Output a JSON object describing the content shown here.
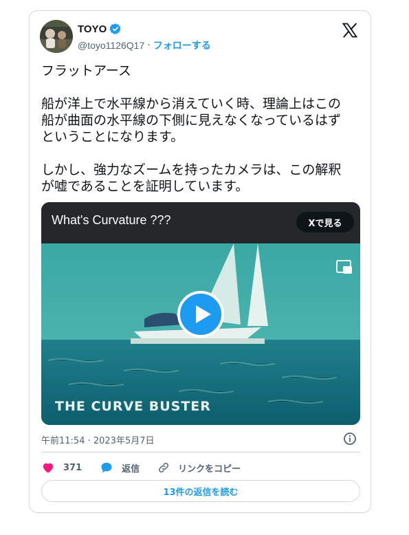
{
  "author": {
    "name": "TOYO",
    "handle": "@toyo1126Q17",
    "separator": "·",
    "follow_label": "フォローする"
  },
  "tweet": {
    "paragraphs": [
      "フラットアース",
      "船が洋上で水平線から消えていく時、理論上はこの\n船が曲面の水平線の下側に見えなくなっているはず\nということになります。",
      "しかし、強力なズームを持ったカメラは、この解釈\nが嘘であることを証明しています。"
    ]
  },
  "media": {
    "title": "What's Curvature  ???",
    "watch_label": "Xで見る",
    "overlay_text": "THE CURVE BUSTER"
  },
  "meta": {
    "timestamp": "午前11:54 · 2023年5月7日"
  },
  "actions": {
    "like_count": "371",
    "reply_label": "返信",
    "copy_link_label": "リンクをコピー"
  },
  "read_replies_label": "13件の返信を読む",
  "colors": {
    "accent": "#1d9bf0",
    "like": "#f91880",
    "text": "#0f1419",
    "muted": "#536471",
    "border": "#cfd9de"
  },
  "icons": {
    "verified": "verified-badge-icon",
    "brand": "x-logo-icon",
    "pip": "picture-in-picture-icon",
    "play": "play-icon",
    "info": "info-icon",
    "like": "heart-icon",
    "reply": "speech-bubble-icon",
    "link": "link-icon"
  }
}
